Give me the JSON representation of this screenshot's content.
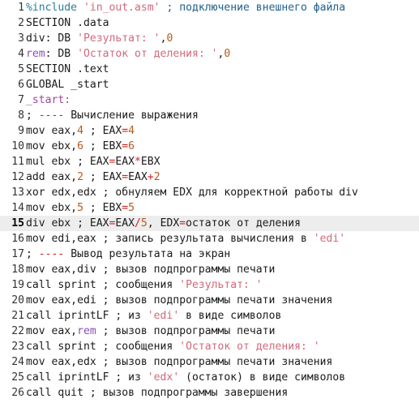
{
  "editor": {
    "current_line": 15,
    "colors": {
      "background": "#ffffff",
      "current_line": "#ededed",
      "comment": "#1f5f8b",
      "string": "#d1697a",
      "number": "#b45a1e",
      "operator": "#cc1f1f",
      "keyword": "#8a4fb3"
    },
    "lines": [
      {
        "n": "1",
        "tokens": [
          [
            "pre",
            "%include "
          ],
          [
            "str",
            "'in_out.asm'"
          ],
          [
            "cmt",
            " ; подключение внешнего файла"
          ]
        ]
      },
      {
        "n": "2",
        "tokens": [
          [
            "tx",
            "SECTION .data"
          ]
        ]
      },
      {
        "n": "3",
        "tokens": [
          [
            "tx",
            "div: DB "
          ],
          [
            "str",
            "'Результат: '"
          ],
          [
            "tx",
            ","
          ],
          [
            "num",
            "0"
          ]
        ]
      },
      {
        "n": "4",
        "tokens": [
          [
            "kw",
            "rem"
          ],
          [
            "tx",
            ": DB "
          ],
          [
            "str",
            "'Остаток от деления: '"
          ],
          [
            "tx",
            ","
          ],
          [
            "num",
            "0"
          ]
        ]
      },
      {
        "n": "5",
        "tokens": [
          [
            "tx",
            "SECTION .text"
          ]
        ]
      },
      {
        "n": "6",
        "tokens": [
          [
            "tx",
            "GLOBAL _start"
          ]
        ]
      },
      {
        "n": "7",
        "tokens": [
          [
            "lbl",
            "_start:"
          ]
        ]
      },
      {
        "n": "8",
        "tokens": [
          [
            "tx",
            "; "
          ],
          [
            "op",
            "----"
          ],
          [
            "tx",
            " Вычисление выражения"
          ]
        ]
      },
      {
        "n": "9",
        "tokens": [
          [
            "tx",
            "mov eax,"
          ],
          [
            "num",
            "4"
          ],
          [
            "tx",
            " ; EAX"
          ],
          [
            "op",
            "="
          ],
          [
            "num",
            "4"
          ]
        ]
      },
      {
        "n": "10",
        "tokens": [
          [
            "tx",
            "mov ebx,"
          ],
          [
            "num",
            "6"
          ],
          [
            "tx",
            " ; EBX"
          ],
          [
            "op",
            "="
          ],
          [
            "num",
            "6"
          ]
        ]
      },
      {
        "n": "11",
        "tokens": [
          [
            "tx",
            "mul ebx ; EAX"
          ],
          [
            "op",
            "="
          ],
          [
            "tx",
            "EAX"
          ],
          [
            "op",
            "*"
          ],
          [
            "tx",
            "EBX"
          ]
        ]
      },
      {
        "n": "12",
        "tokens": [
          [
            "tx",
            "add eax,"
          ],
          [
            "num",
            "2"
          ],
          [
            "tx",
            " ; EAX"
          ],
          [
            "op",
            "="
          ],
          [
            "tx",
            "EAX"
          ],
          [
            "op",
            "+"
          ],
          [
            "num",
            "2"
          ]
        ]
      },
      {
        "n": "13",
        "tokens": [
          [
            "tx",
            "xor edx,edx ; обнуляем EDX для корректной работы div"
          ]
        ]
      },
      {
        "n": "14",
        "tokens": [
          [
            "tx",
            "mov ebx,"
          ],
          [
            "num",
            "5"
          ],
          [
            "tx",
            " ; EBX"
          ],
          [
            "op",
            "="
          ],
          [
            "num",
            "5"
          ]
        ]
      },
      {
        "n": "15",
        "tokens": [
          [
            "tx",
            "div ebx ; EAX"
          ],
          [
            "op",
            "="
          ],
          [
            "tx",
            "EAX"
          ],
          [
            "op",
            "/"
          ],
          [
            "num",
            "5"
          ],
          [
            "tx",
            ", EDX"
          ],
          [
            "op",
            "="
          ],
          [
            "tx",
            "остаток от деления"
          ]
        ]
      },
      {
        "n": "16",
        "tokens": [
          [
            "tx",
            "mov edi,eax ; запись результата вычисления в "
          ],
          [
            "str",
            "'edi'"
          ]
        ]
      },
      {
        "n": "17",
        "tokens": [
          [
            "tx",
            "; "
          ],
          [
            "op",
            "----"
          ],
          [
            "tx",
            " Вывод результата на экран"
          ]
        ]
      },
      {
        "n": "18",
        "tokens": [
          [
            "tx",
            "mov eax,div ; вызов подпрограммы печати"
          ]
        ]
      },
      {
        "n": "19",
        "tokens": [
          [
            "tx",
            "call sprint ; сообщения "
          ],
          [
            "str",
            "'Результат: '"
          ]
        ]
      },
      {
        "n": "20",
        "tokens": [
          [
            "tx",
            "mov eax,edi ; вызов подпрограммы печати значения"
          ]
        ]
      },
      {
        "n": "21",
        "tokens": [
          [
            "tx",
            "call iprintLF ; из "
          ],
          [
            "str",
            "'edi'"
          ],
          [
            "tx",
            " в виде символов"
          ]
        ]
      },
      {
        "n": "22",
        "tokens": [
          [
            "tx",
            "mov eax,"
          ],
          [
            "kw",
            "rem"
          ],
          [
            "tx",
            " ; вызов подпрограммы печати"
          ]
        ]
      },
      {
        "n": "23",
        "tokens": [
          [
            "tx",
            "call sprint ; сообщения "
          ],
          [
            "str",
            "'Остаток от деления: '"
          ]
        ]
      },
      {
        "n": "24",
        "tokens": [
          [
            "tx",
            "mov eax,edx ; вызов подпрограммы печати значения"
          ]
        ]
      },
      {
        "n": "25",
        "tokens": [
          [
            "tx",
            "call iprintLF ; из "
          ],
          [
            "str",
            "'edx'"
          ],
          [
            "tx",
            " (остаток) в виде символов"
          ]
        ]
      },
      {
        "n": "26",
        "tokens": [
          [
            "tx",
            "call quit ; вызов подпрограммы завершения"
          ]
        ]
      }
    ]
  }
}
